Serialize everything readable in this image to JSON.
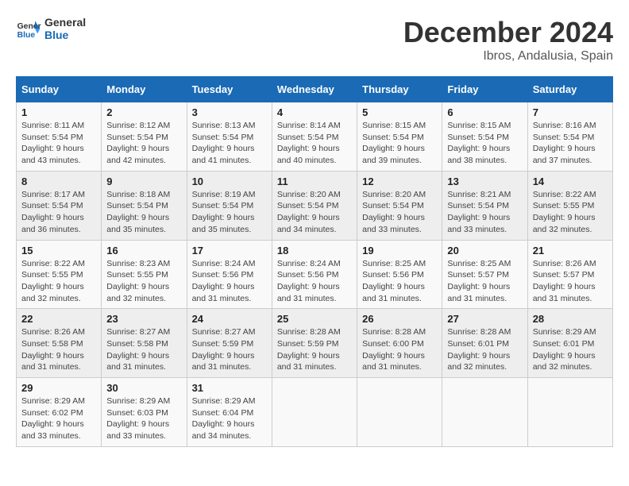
{
  "logo": {
    "text_general": "General",
    "text_blue": "Blue"
  },
  "header": {
    "month": "December 2024",
    "location": "Ibros, Andalusia, Spain"
  },
  "columns": [
    "Sunday",
    "Monday",
    "Tuesday",
    "Wednesday",
    "Thursday",
    "Friday",
    "Saturday"
  ],
  "weeks": [
    [
      {
        "day": "1",
        "sunrise": "8:11 AM",
        "sunset": "5:54 PM",
        "daylight": "9 hours and 43 minutes."
      },
      {
        "day": "2",
        "sunrise": "8:12 AM",
        "sunset": "5:54 PM",
        "daylight": "9 hours and 42 minutes."
      },
      {
        "day": "3",
        "sunrise": "8:13 AM",
        "sunset": "5:54 PM",
        "daylight": "9 hours and 41 minutes."
      },
      {
        "day": "4",
        "sunrise": "8:14 AM",
        "sunset": "5:54 PM",
        "daylight": "9 hours and 40 minutes."
      },
      {
        "day": "5",
        "sunrise": "8:15 AM",
        "sunset": "5:54 PM",
        "daylight": "9 hours and 39 minutes."
      },
      {
        "day": "6",
        "sunrise": "8:15 AM",
        "sunset": "5:54 PM",
        "daylight": "9 hours and 38 minutes."
      },
      {
        "day": "7",
        "sunrise": "8:16 AM",
        "sunset": "5:54 PM",
        "daylight": "9 hours and 37 minutes."
      }
    ],
    [
      {
        "day": "8",
        "sunrise": "8:17 AM",
        "sunset": "5:54 PM",
        "daylight": "9 hours and 36 minutes."
      },
      {
        "day": "9",
        "sunrise": "8:18 AM",
        "sunset": "5:54 PM",
        "daylight": "9 hours and 35 minutes."
      },
      {
        "day": "10",
        "sunrise": "8:19 AM",
        "sunset": "5:54 PM",
        "daylight": "9 hours and 35 minutes."
      },
      {
        "day": "11",
        "sunrise": "8:20 AM",
        "sunset": "5:54 PM",
        "daylight": "9 hours and 34 minutes."
      },
      {
        "day": "12",
        "sunrise": "8:20 AM",
        "sunset": "5:54 PM",
        "daylight": "9 hours and 33 minutes."
      },
      {
        "day": "13",
        "sunrise": "8:21 AM",
        "sunset": "5:54 PM",
        "daylight": "9 hours and 33 minutes."
      },
      {
        "day": "14",
        "sunrise": "8:22 AM",
        "sunset": "5:55 PM",
        "daylight": "9 hours and 32 minutes."
      }
    ],
    [
      {
        "day": "15",
        "sunrise": "8:22 AM",
        "sunset": "5:55 PM",
        "daylight": "9 hours and 32 minutes."
      },
      {
        "day": "16",
        "sunrise": "8:23 AM",
        "sunset": "5:55 PM",
        "daylight": "9 hours and 32 minutes."
      },
      {
        "day": "17",
        "sunrise": "8:24 AM",
        "sunset": "5:56 PM",
        "daylight": "9 hours and 31 minutes."
      },
      {
        "day": "18",
        "sunrise": "8:24 AM",
        "sunset": "5:56 PM",
        "daylight": "9 hours and 31 minutes."
      },
      {
        "day": "19",
        "sunrise": "8:25 AM",
        "sunset": "5:56 PM",
        "daylight": "9 hours and 31 minutes."
      },
      {
        "day": "20",
        "sunrise": "8:25 AM",
        "sunset": "5:57 PM",
        "daylight": "9 hours and 31 minutes."
      },
      {
        "day": "21",
        "sunrise": "8:26 AM",
        "sunset": "5:57 PM",
        "daylight": "9 hours and 31 minutes."
      }
    ],
    [
      {
        "day": "22",
        "sunrise": "8:26 AM",
        "sunset": "5:58 PM",
        "daylight": "9 hours and 31 minutes."
      },
      {
        "day": "23",
        "sunrise": "8:27 AM",
        "sunset": "5:58 PM",
        "daylight": "9 hours and 31 minutes."
      },
      {
        "day": "24",
        "sunrise": "8:27 AM",
        "sunset": "5:59 PM",
        "daylight": "9 hours and 31 minutes."
      },
      {
        "day": "25",
        "sunrise": "8:28 AM",
        "sunset": "5:59 PM",
        "daylight": "9 hours and 31 minutes."
      },
      {
        "day": "26",
        "sunrise": "8:28 AM",
        "sunset": "6:00 PM",
        "daylight": "9 hours and 31 minutes."
      },
      {
        "day": "27",
        "sunrise": "8:28 AM",
        "sunset": "6:01 PM",
        "daylight": "9 hours and 32 minutes."
      },
      {
        "day": "28",
        "sunrise": "8:29 AM",
        "sunset": "6:01 PM",
        "daylight": "9 hours and 32 minutes."
      }
    ],
    [
      {
        "day": "29",
        "sunrise": "8:29 AM",
        "sunset": "6:02 PM",
        "daylight": "9 hours and 33 minutes."
      },
      {
        "day": "30",
        "sunrise": "8:29 AM",
        "sunset": "6:03 PM",
        "daylight": "9 hours and 33 minutes."
      },
      {
        "day": "31",
        "sunrise": "8:29 AM",
        "sunset": "6:04 PM",
        "daylight": "9 hours and 34 minutes."
      },
      null,
      null,
      null,
      null
    ]
  ]
}
